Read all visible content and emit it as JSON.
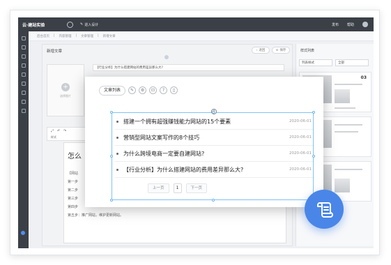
{
  "topbar": {
    "logo": "云·建站实验",
    "edit_link": "进入设计",
    "right_items": [
      "发布",
      "帮助"
    ]
  },
  "breadcrumb": [
    "后台首页",
    "内容管理",
    "文章管理",
    "新增文章"
  ],
  "editor": {
    "page_title": "新增文章",
    "back_label": "退回",
    "save_label": "保存",
    "upload_label": "选择图片",
    "title_value": "【行业分析】为什么搭建网站的费用差异那么大?",
    "format_select": "样式",
    "doc_heading": "怎么",
    "doc_lines": [
      "【网站",
      "第一步",
      "第二步",
      "第三步",
      "第四步",
      "第五步：推广网站，维护更新网站。"
    ]
  },
  "style_panel": {
    "title": "样式列表",
    "filter_select": "列表样式",
    "filter_value": "全部",
    "tiles": [
      {
        "num": "03"
      },
      {
        "num": ""
      },
      {
        "num": ""
      }
    ]
  },
  "modal": {
    "toolbar_pill": "文章列表",
    "toolbar_icons": [
      "edit-doc-icon",
      "settings-icon",
      "lock-icon",
      "help-icon",
      "trash-icon"
    ],
    "articles": [
      {
        "title": "搭建一个拥有超强赚钱能力网站的15个要素",
        "date": "2020-06-01"
      },
      {
        "title": "营销型网站文案写作的8个技巧",
        "date": "2020-06-01"
      },
      {
        "title": "为什么跨境电商一定要自建网站?",
        "date": "2020-06-01"
      },
      {
        "title": "【行业分析】为什么搭建网站的费用差异那么大?",
        "date": "2020-06-01"
      }
    ],
    "pager": {
      "prev": "上一页",
      "current": "1",
      "next": "下一页"
    }
  },
  "colors": {
    "accent": "#4a86e8",
    "sidebar": "#3b4047",
    "selection": "#7fc3f1"
  }
}
